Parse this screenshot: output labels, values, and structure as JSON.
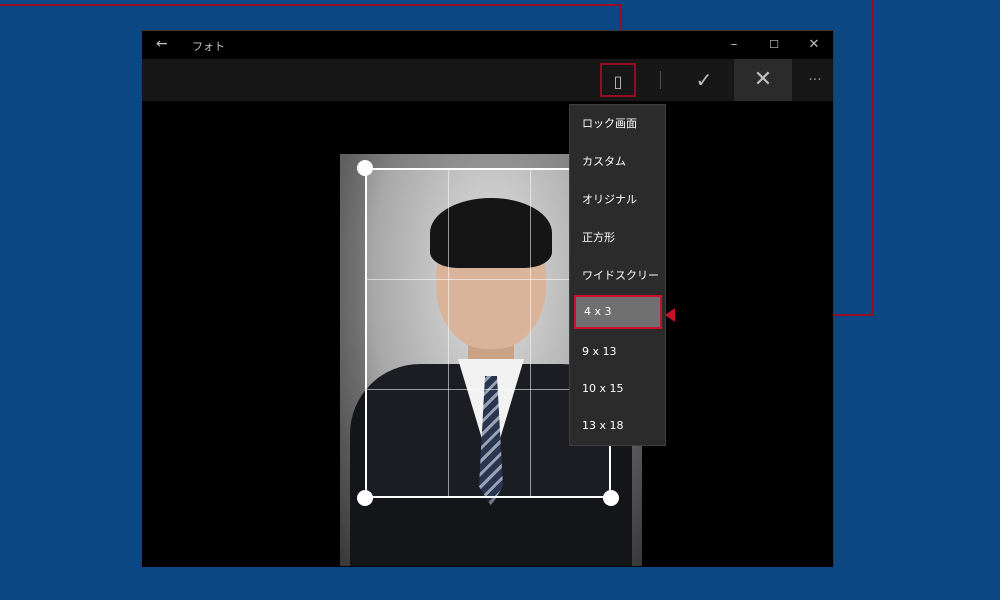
{
  "window": {
    "title": "フォト",
    "back_glyph": "←",
    "minimize_glyph": "–",
    "maximize_glyph": "☐",
    "close_glyph": "✕"
  },
  "toolbar": {
    "aspect_ratio_glyph": "▯",
    "apply_glyph": "✓",
    "cancel_glyph": "✕",
    "more_glyph": "···"
  },
  "aspect_menu": {
    "items": [
      {
        "label": "ロック画面"
      },
      {
        "label": "カスタム"
      },
      {
        "label": "オリジナル"
      },
      {
        "label": "正方形"
      },
      {
        "label": "ワイドスクリーン"
      },
      {
        "label": "4 x 3"
      },
      {
        "label": "9 x 13"
      },
      {
        "label": "10 x 15"
      },
      {
        "label": "13 x 18"
      }
    ],
    "selected_label": "4 x 3"
  },
  "colors": {
    "desktop": "#0f5fae",
    "annotation": "#c8102e",
    "menu_bg": "#2b2b2b",
    "menu_selected": "#707070"
  }
}
